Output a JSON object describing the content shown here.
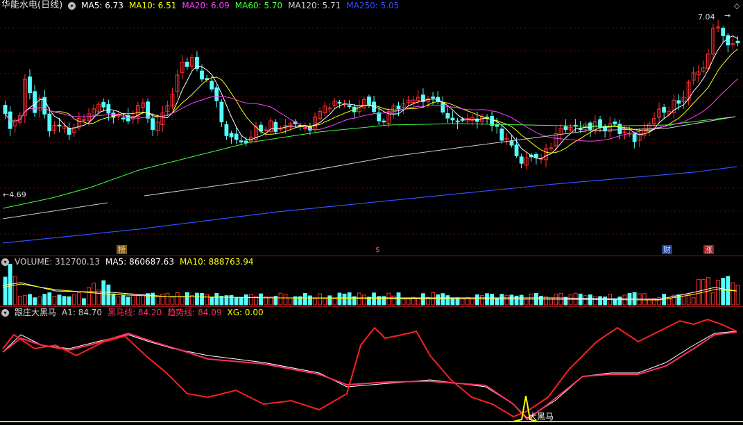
{
  "stock": {
    "title": "华能水电(日线)"
  },
  "price_panel": {
    "ma_labels": [
      {
        "text": "MA5: 6.73",
        "color": "#ffffff"
      },
      {
        "text": "MA10: 6.51",
        "color": "#ffff00"
      },
      {
        "text": "MA20: 6.09",
        "color": "#ff40ff"
      },
      {
        "text": "MA60: 5.70",
        "color": "#40ff40"
      },
      {
        "text": "MA120: 5.71",
        "color": "#cccccc"
      },
      {
        "text": "MA250: 5.05",
        "color": "#3050ff"
      }
    ],
    "high_label": "7.04",
    "low_label": "4.69",
    "markers": [
      "榜",
      "$",
      "财",
      "涨"
    ]
  },
  "volume_panel": {
    "labels": [
      {
        "text": "VOLUME: 312700.13",
        "color": "#cccccc"
      },
      {
        "text": "MA5: 860687.63",
        "color": "#ffffff"
      },
      {
        "text": "MA10: 888763.94",
        "color": "#ffff00"
      }
    ]
  },
  "indicator_panel": {
    "title": "跟庄大黑马",
    "labels": [
      {
        "text": "A1: 84.70",
        "color": "#cccccc"
      },
      {
        "text": "黑马线: 84.20",
        "color": "#ff3060"
      },
      {
        "text": "趋势线: 84.09",
        "color": "#ff3060"
      },
      {
        "text": "XG: 0.00",
        "color": "#ffff00"
      }
    ],
    "signal_label": "大黑马"
  },
  "colors": {
    "up": "#ff3030",
    "down": "#54ffff",
    "grid": "#8b1a1a",
    "ma5": "#ffffff",
    "ma10": "#ffff00",
    "ma20": "#ff40ff",
    "ma60": "#40ff40",
    "ma120": "#cccccc",
    "ma250": "#3050ff"
  }
}
